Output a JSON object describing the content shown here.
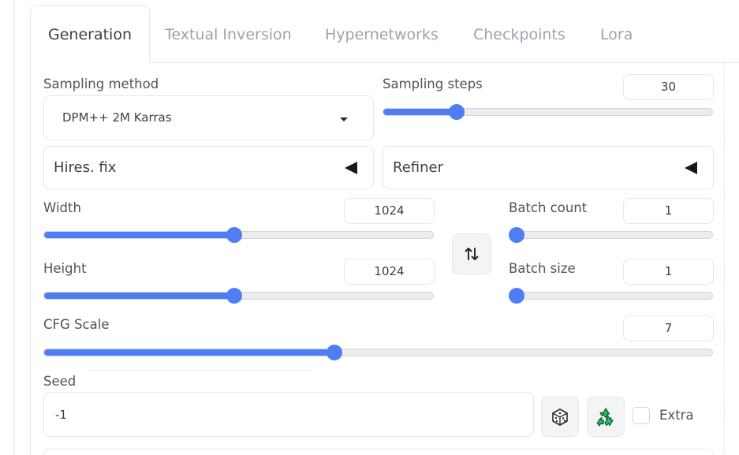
{
  "tabs": [
    {
      "label": "Generation",
      "active": true
    },
    {
      "label": "Textual Inversion",
      "active": false
    },
    {
      "label": "Hypernetworks",
      "active": false
    },
    {
      "label": "Checkpoints",
      "active": false
    },
    {
      "label": "Lora",
      "active": false
    }
  ],
  "sampling_method": {
    "label": "Sampling method",
    "value": "DPM++ 2M Karras"
  },
  "sampling_steps": {
    "label": "Sampling steps",
    "value": "30",
    "fraction": 0.211
  },
  "hires_fix": {
    "label": "Hires. fix"
  },
  "refiner": {
    "label": "Refiner"
  },
  "width": {
    "label": "Width",
    "value": "1024",
    "fraction": 0.488
  },
  "height": {
    "label": "Height",
    "value": "1024",
    "fraction": 0.488
  },
  "batch_count": {
    "label": "Batch count",
    "value": "1",
    "fraction": 0.0
  },
  "batch_size": {
    "label": "Batch size",
    "value": "1",
    "fraction": 0.0
  },
  "cfg_scale": {
    "label": "CFG Scale",
    "value": "7",
    "fraction": 0.433
  },
  "seed": {
    "label": "Seed",
    "value": "-1"
  },
  "extra": {
    "label": "Extra",
    "checked": false
  },
  "colors": {
    "accent": "#4f7df5",
    "recycle_green": "#22c55e"
  },
  "icons": {
    "swap": "swap-arrows-icon",
    "dice": "dice-icon",
    "recycle": "recycle-icon",
    "dropdown": "caret-down-icon",
    "accordion": "triangle-left-icon"
  }
}
